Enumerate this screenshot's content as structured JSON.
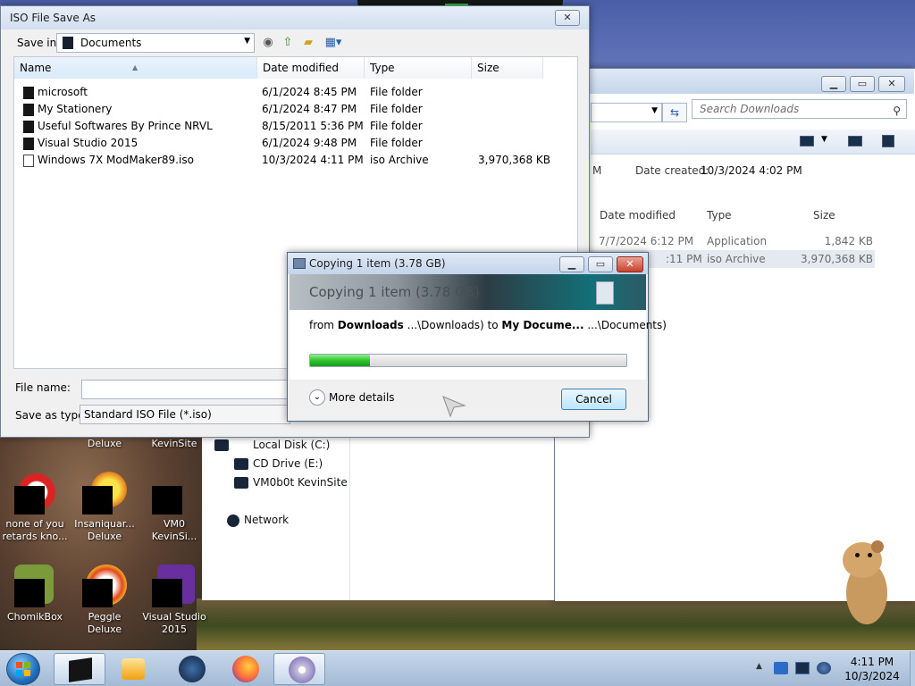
{
  "explorer": {
    "search_placeholder": "Search Downloads",
    "details_partial": "M",
    "date_created_label": "Date created:",
    "date_created_value": "10/3/2024 4:02 PM",
    "columns": {
      "date": "Date modified",
      "type": "Type",
      "size": "Size"
    },
    "rows": [
      {
        "date": "7/7/2024 6:12 PM",
        "type": "Application",
        "size": "1,842 KB"
      },
      {
        "date": ":11 PM",
        "type": "iso Archive",
        "size": "3,970,368 KB"
      }
    ],
    "nav": [
      "Local Disk (C:)",
      "CD Drive (E:)",
      "VM0b0t KevinSite",
      "Network"
    ]
  },
  "save_dialog": {
    "title": "ISO File Save As",
    "save_in_label": "Save in:",
    "save_in_value": "Documents",
    "columns": {
      "name": "Name",
      "date": "Date modified",
      "type": "Type",
      "size": "Size"
    },
    "rows": [
      {
        "name": "microsoft",
        "date": "6/1/2024 8:45 PM",
        "type": "File folder",
        "size": "",
        "icon": "folder-icon"
      },
      {
        "name": "My Stationery",
        "date": "6/1/2024 8:47 PM",
        "type": "File folder",
        "size": "",
        "icon": "folder-icon"
      },
      {
        "name": "Useful Softwares By Prince NRVL",
        "date": "8/15/2011 5:36 PM",
        "type": "File folder",
        "size": "",
        "icon": "folder-icon"
      },
      {
        "name": "Visual Studio 2015",
        "date": "6/1/2024 9:48 PM",
        "type": "File folder",
        "size": "",
        "icon": "folder-icon"
      },
      {
        "name": "Windows 7X ModMaker89.iso",
        "date": "10/3/2024 4:11 PM",
        "type": "iso Archive",
        "size": "3,970,368 KB",
        "icon": "iso-file-icon"
      }
    ],
    "file_name_label": "File name:",
    "file_name_value": "",
    "save_as_type_label": "Save as type:",
    "save_as_type_value": "Standard ISO File (*.iso)"
  },
  "copy_dialog": {
    "title": "Copying 1 item (3.78 GB)",
    "banner": "Copying 1 item (3.78 GB)",
    "from_word": "from",
    "from_bold": "Downloads",
    "from_path": "...\\Downloads)",
    "to_word": "to",
    "to_bold": "My Docume...",
    "to_path": "...\\Documents)",
    "progress_percent": 19,
    "more_details": "More details",
    "cancel": "Cancel"
  },
  "desktop_icons": [
    {
      "label": "Deluxe"
    },
    {
      "label": "KevinSite"
    },
    {
      "label": "none of you retards kno..."
    },
    {
      "label": "Insaniquar... Deluxe"
    },
    {
      "label": "VM0 KevinSi..."
    },
    {
      "label": "ChomikBox"
    },
    {
      "label": "Peggle Deluxe"
    },
    {
      "label": "Visual Studio 2015"
    }
  ],
  "taskbar": {
    "clock_time": "4:11 PM",
    "clock_date": "10/3/2024"
  }
}
